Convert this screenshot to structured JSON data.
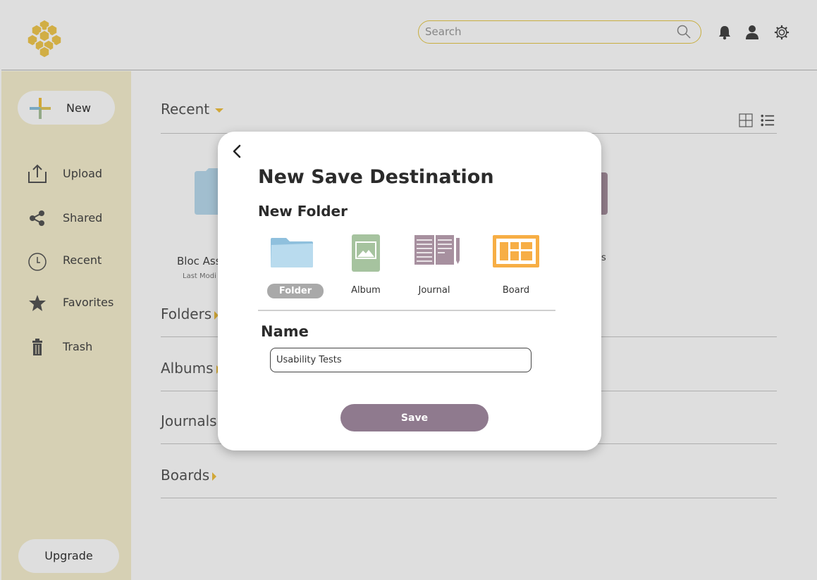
{
  "header": {
    "search_placeholder": "Search",
    "logo_icon": "honeycomb-logo",
    "icons": [
      "bell-icon",
      "user-icon",
      "gear-icon"
    ]
  },
  "sidebar": {
    "new_label": "New",
    "items": [
      {
        "label": "Upload",
        "icon": "upload-icon"
      },
      {
        "label": "Shared",
        "icon": "share-icon"
      },
      {
        "label": "Recent",
        "icon": "clock-icon"
      },
      {
        "label": "Favorites",
        "icon": "star-icon"
      },
      {
        "label": "Trash",
        "icon": "trash-icon"
      }
    ],
    "upgrade_label": "Upgrade"
  },
  "main": {
    "recent_title": "Recent",
    "sections": [
      "Folders",
      "Albums",
      "Journals",
      "Boards"
    ],
    "recent_card_label": "Bloc Ass",
    "recent_card_sub": "Last Modi",
    "right_card_fragment": "s"
  },
  "modal": {
    "title": "New Save Destination",
    "subtitle": "New Folder",
    "types": [
      {
        "label": "Folder",
        "icon": "folder-icon",
        "selected": true
      },
      {
        "label": "Album",
        "icon": "album-icon",
        "selected": false
      },
      {
        "label": "Journal",
        "icon": "journal-icon",
        "selected": false
      },
      {
        "label": "Board",
        "icon": "board-icon",
        "selected": false
      }
    ],
    "name_label": "Name",
    "name_value": "Usability Tests",
    "save_label": "Save"
  },
  "colors": {
    "accent_yellow": "#f0c040",
    "sidebar_bg": "#f6efcf",
    "save_button": "#8f7a8e",
    "folder_blue": "#b9dbee",
    "album_green": "#a6c39f",
    "journal_purple": "#a7909f",
    "board_orange": "#f7ae45"
  }
}
